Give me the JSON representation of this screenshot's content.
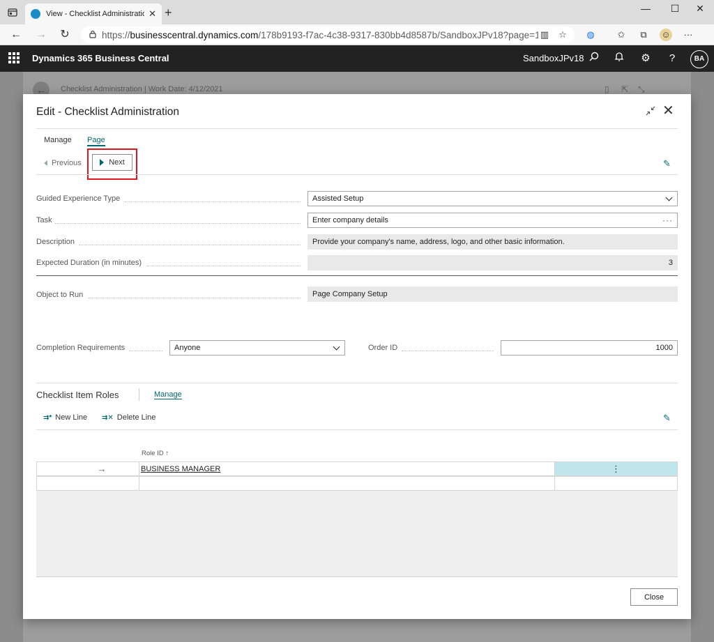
{
  "browser": {
    "tab_title": "View - Checklist Administration",
    "url_scheme": "https://",
    "url_domain": "businesscentral.dynamics.com",
    "url_path": "/178b9193-f7ac-4c38-9317-830bb4d8587b/SandboxJPv18?page=19..."
  },
  "app": {
    "title": "Dynamics 365 Business Central",
    "environment": "SandboxJPv18",
    "user_initials": "BA"
  },
  "background_page": {
    "title": "Checklist Administration | Work Date: 4/12/2021"
  },
  "dialog": {
    "title": "Edit - Checklist Administration",
    "menu": {
      "manage": "Manage",
      "page": "Page"
    },
    "actions": {
      "previous": "Previous",
      "next": "Next"
    },
    "fields": {
      "guided_experience_type": {
        "label": "Guided Experience Type",
        "value": "Assisted Setup"
      },
      "task": {
        "label": "Task",
        "value": "Enter company details"
      },
      "description": {
        "label": "Description",
        "value": "Provide your company's name, address, logo, and other basic information."
      },
      "expected_duration": {
        "label": "Expected Duration (in minutes)",
        "value": "3"
      },
      "object_to_run": {
        "label": "Object to Run",
        "value": "Page Company Setup"
      },
      "completion_requirements": {
        "label": "Completion Requirements",
        "value": "Anyone"
      },
      "order_id": {
        "label": "Order ID",
        "value": "1000"
      }
    },
    "roles_part": {
      "title": "Checklist Item Roles",
      "manage_tab": "Manage",
      "new_line": "New Line",
      "delete_line": "Delete Line",
      "column_header": "Role ID ↑",
      "rows": [
        {
          "role_id": "BUSINESS MANAGER"
        }
      ]
    },
    "close_label": "Close"
  }
}
